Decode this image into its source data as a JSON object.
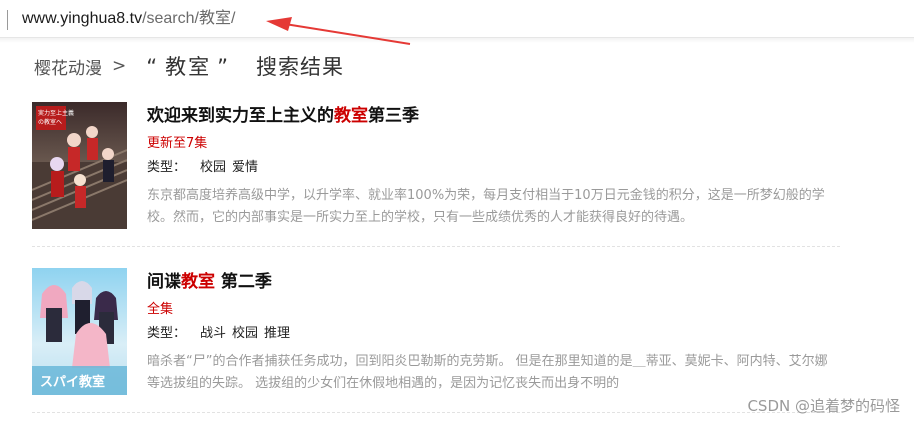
{
  "address_bar": {
    "host": "www.yinghua8.tv",
    "path": "/search/教室/"
  },
  "breadcrumb": {
    "home": "樱花动漫",
    "separator": ">",
    "open_quote": "“",
    "query": "教室",
    "close_quote": "”",
    "title": "搜索结果"
  },
  "results": [
    {
      "title_before": "欢迎来到实力至上主义的",
      "title_highlight": "教室",
      "title_after": "第三季",
      "status": "更新至7集",
      "genre_label": "类型：",
      "genres": [
        "校园",
        "爱情"
      ],
      "description": "东京都高度培养高级中学，以升学率、就业率100%为荣，每月支付相当于10万日元金钱的积分，这是一所梦幻般的学校。然而，它的内部事实是一所实力至上的学校，只有一些成绩优秀的人才能获得良好的待遇。",
      "poster_text": [
        "実力至上主義",
        "の教室へ"
      ]
    },
    {
      "title_before": "间谍",
      "title_highlight": "教室",
      "title_after": " 第二季",
      "status": "全集",
      "genre_label": "类型：",
      "genres": [
        "战斗",
        "校园",
        "推理"
      ],
      "description": "暗杀者“尸”的合作者捕获任务成功，回到阳炎巴勒斯的克劳斯。 但是在那里知道的是＿蒂亚、莫妮卡、阿内特、艾尔娜等选拔组的失踪。 选拔组的少女们在休假地相遇的，是因为记忆丧失而出身不明的",
      "poster_text": [
        "スパイ教室"
      ]
    }
  ],
  "watermark": "CSDN @追着梦的码怪",
  "colors": {
    "highlight": "#cc0000",
    "arrow": "#e53935",
    "description": "#9a9a9a"
  }
}
